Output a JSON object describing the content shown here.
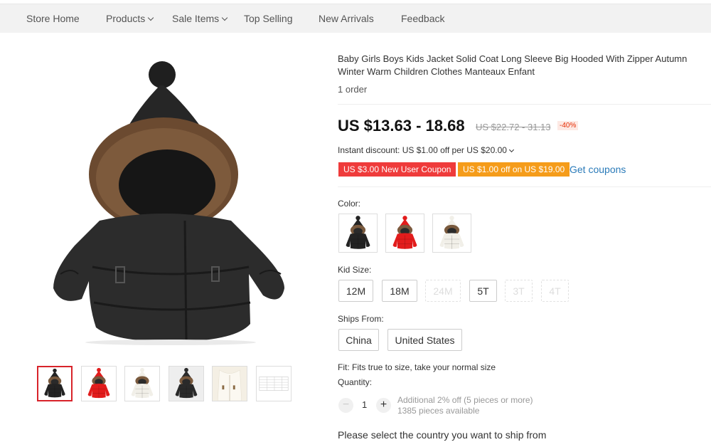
{
  "nav": {
    "items": [
      {
        "label": "Store Home",
        "dropdown": false
      },
      {
        "label": "Products",
        "dropdown": true
      },
      {
        "label": "Sale Items",
        "dropdown": true
      },
      {
        "label": "Top Selling",
        "dropdown": false
      },
      {
        "label": "New Arrivals",
        "dropdown": false
      },
      {
        "label": "Feedback",
        "dropdown": false
      }
    ]
  },
  "product": {
    "title": "Baby Girls Boys Kids Jacket Solid Coat Long Sleeve Big Hooded With Zipper Autumn Winter Warm Children Clothes Manteaux Enfant",
    "orders": "1 order",
    "price": "US $13.63 - 18.68",
    "price_old": "US $22.72 - 31.13",
    "discount": "-40%",
    "instant_discount": "Instant discount: US $1.00 off per US $20.00",
    "coupons": [
      "US $3.00 New User Coupon",
      "US $1.00 off on US $19.00"
    ],
    "get_coupons": "Get coupons",
    "color_label": "Color:",
    "colors": [
      "black",
      "red",
      "white"
    ],
    "size_label": "Kid Size:",
    "sizes": [
      {
        "label": "12M",
        "available": true
      },
      {
        "label": "18M",
        "available": true
      },
      {
        "label": "24M",
        "available": false
      },
      {
        "label": "5T",
        "available": true
      },
      {
        "label": "3T",
        "available": false
      },
      {
        "label": "4T",
        "available": false
      }
    ],
    "ships_from_label": "Ships From:",
    "ships_from": [
      "China",
      "United States"
    ],
    "fit": "Fit: Fits true to size, take your normal size",
    "quantity_label": "Quantity:",
    "quantity": "1",
    "quantity_minus": "−",
    "quantity_plus": "+",
    "bulk_note": "Additional 2% off (5 pieces or more)",
    "available_note": "1385 pieces available",
    "ship_message": "Please select the country you want to ship from"
  },
  "colors": {
    "accent_red": "#d8232a",
    "coupon_red": "#ef3b3b",
    "coupon_orange": "#f59c1a",
    "link_blue": "#2b7bb9"
  }
}
